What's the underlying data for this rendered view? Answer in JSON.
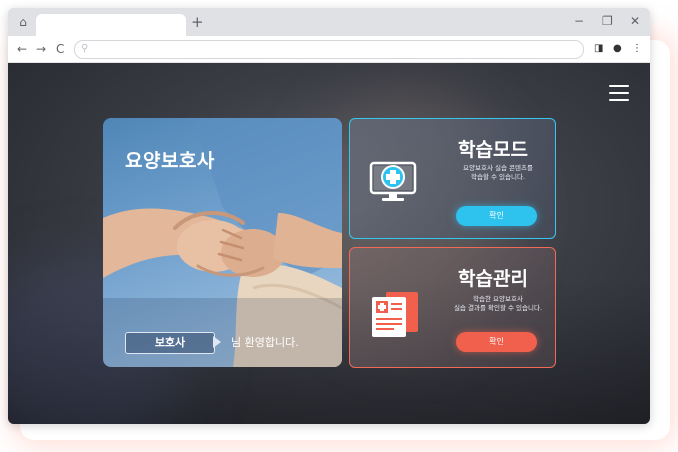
{
  "browser": {
    "new_tab_label": "+",
    "window_controls": {
      "minimize": "−",
      "restore": "❐",
      "close": "✕"
    },
    "nav": {
      "back": "←",
      "forward": "→",
      "reload": "C"
    },
    "toolbar_icons": {
      "sidebar": "◨",
      "profile": "●",
      "menu": "⋮"
    }
  },
  "hero": {
    "title": "요양보호사",
    "role_label": "보호사",
    "welcome_text": "님 환영합니다."
  },
  "cards": {
    "learn": {
      "title": "학습모드",
      "desc_line1": "요양보호사 실습 콘텐츠를",
      "desc_line2": "학습할 수 있습니다.",
      "button_label": "확인",
      "accent": "#2dc3ee",
      "icon": "monitor-medical-icon"
    },
    "manage": {
      "title": "학습관리",
      "desc_line1": "학습한 요양보호사",
      "desc_line2": "실습 결과를 확인할 수 있습니다.",
      "button_label": "확인",
      "accent": "#f0604c",
      "icon": "medical-documents-icon"
    }
  }
}
